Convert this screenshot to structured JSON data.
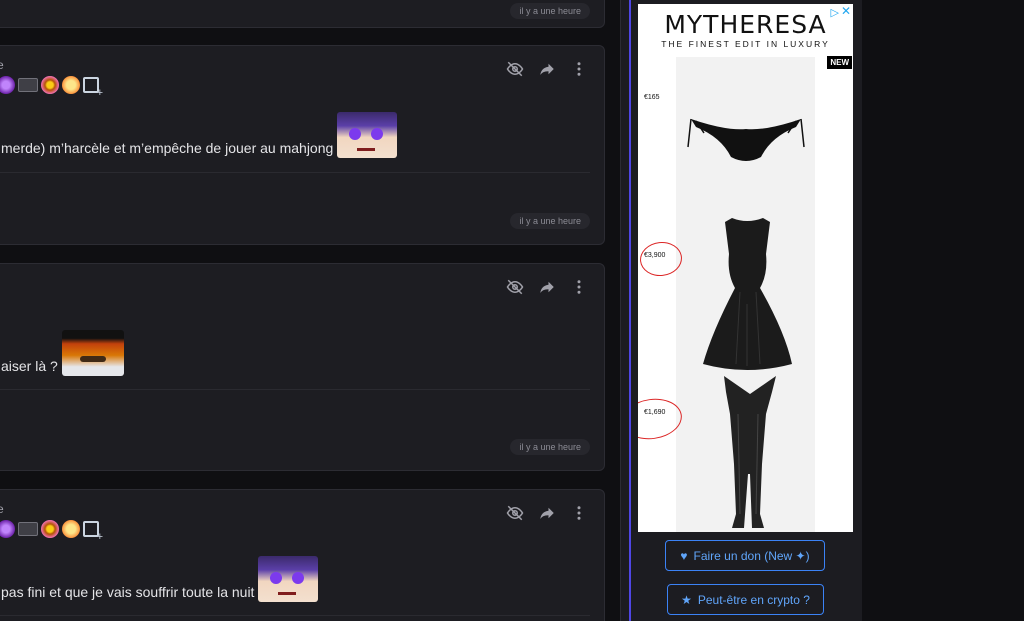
{
  "posts": [
    {
      "time": "il y a une heure"
    },
    {
      "name": "e",
      "message": "merde) m’harcèle et m’empêche de jouer au mahjong",
      "time": "il y a une heure"
    },
    {
      "message": "aiser là ?",
      "time": "il y a une heure"
    },
    {
      "name": "e",
      "message": "pas fini et que je vais souffrir toute la nuit"
    }
  ],
  "ad": {
    "brand": "MYTHERESA",
    "tagline": "THE FINEST EDIT IN LUXURY",
    "badge": "NEW",
    "products": [
      {
        "price": "€165",
        "item": "bikini-bottom"
      },
      {
        "price": "€3,900",
        "item": "leather-dress"
      },
      {
        "price": "€1,690",
        "item": "leggings"
      }
    ]
  },
  "sidebar": {
    "donate_label": "Faire un don (New ✦)",
    "crypto_label": "Peut-être en crypto ?"
  },
  "colors": {
    "accent": "#3b82f6",
    "card": "#1d1d22",
    "background": "#0f0f12",
    "annotation": "#dc2626"
  }
}
